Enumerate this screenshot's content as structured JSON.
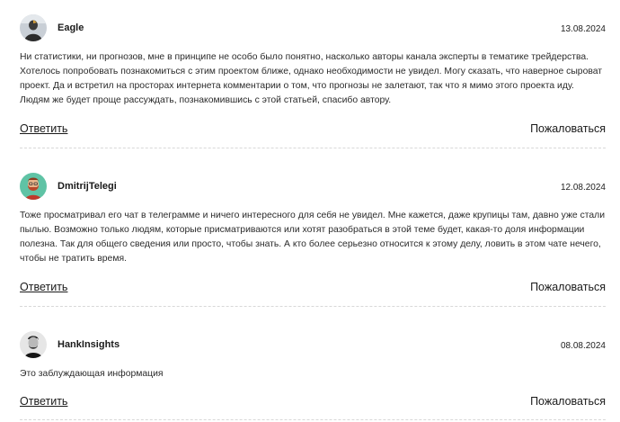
{
  "comments": [
    {
      "author": "Eagle",
      "date": "13.08.2024",
      "avatar_icon": "eagle-avatar",
      "text": "Ни статистики, ни прогнозов, мне в принципе не особо было понятно, насколько авторы канала эксперты в тематике трейдерства. Хотелось попробовать познакомиться с этим проектом ближе, однако необходимости не увидел. Могу сказать, что наверное сыроват проект. Да и встретил на просторах интернета комментарии о том, что прогнозы не залетают, так что я мимо этого проекта иду. Людям же будет проще рассуждать, познакомившись с этой статьей, спасибо автору.",
      "reply_label": "Ответить",
      "complain_label": "Пожаловаться"
    },
    {
      "author": "DmitrijTelegi",
      "date": "12.08.2024",
      "avatar_icon": "bearded-man-avatar",
      "text": "Тоже просматривал его чат в телеграмме и ничего интересного для себя не увидел. Мне кажется, даже крупицы там, давно уже стали пылью. Возможно только людям, которые присматриваются или хотят разобраться в этой теме будет, какая-то доля информации полезна. Так для общего сведения или просто, чтобы знать. А кто более серьезно относится к этому делу, ловить в этом чате нечего, чтобы не тратить время.",
      "reply_label": "Ответить",
      "complain_label": "Пожаловаться"
    },
    {
      "author": "HankInsights",
      "date": "08.08.2024",
      "avatar_icon": "man-portrait-avatar",
      "text": "Это заблуждающая информация",
      "reply_label": "Ответить",
      "complain_label": "Пожаловаться"
    }
  ],
  "colors": {
    "text": "#222222",
    "divider": "#d8d8d8",
    "avatar2_bg": "#5fc3a5"
  }
}
